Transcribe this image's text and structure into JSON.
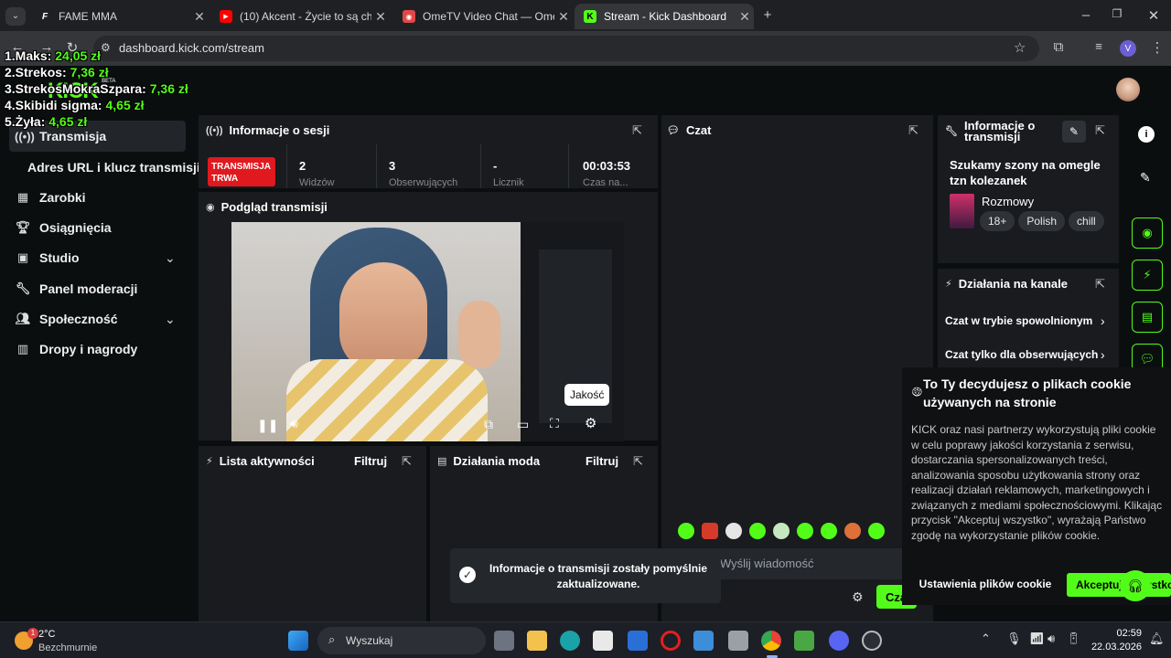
{
  "tabs": [
    {
      "title": "FAME MMA",
      "icon": "fame-icon"
    },
    {
      "title": "(10) Akcent - Życie to są chwile",
      "icon": "youtube-icon"
    },
    {
      "title": "OmeTV Video Chat — Omegle",
      "icon": "ometv-icon"
    },
    {
      "title": "Stream - Kick Dashboard",
      "icon": "kick-icon"
    }
  ],
  "url": "dashboard.kick.com/stream",
  "profile_initial": "V",
  "overlay": [
    {
      "name": "1.Maks:",
      "amount": "24,05 zł"
    },
    {
      "name": "2.Strekos:",
      "amount": "7,36 zł"
    },
    {
      "name": "3.StrekosMokraSzpara:",
      "amount": "7,36 zł"
    },
    {
      "name": "4.Skibidi sigma:",
      "amount": "4,65 zł"
    },
    {
      "name": "5.Żyła:",
      "amount": "4,65 zł"
    }
  ],
  "logo": {
    "text": "KICK",
    "badge": "BETA"
  },
  "sidebar": {
    "items": [
      {
        "label": "Transmisja",
        "icon": "broadcast-icon"
      },
      {
        "label": "Adres URL i klucz transmisji",
        "icon": ""
      },
      {
        "label": "Zarobki",
        "icon": "earnings-icon"
      },
      {
        "label": "Osiągnięcia",
        "icon": "trophy-icon"
      },
      {
        "label": "Studio",
        "icon": "studio-icon"
      },
      {
        "label": "Panel moderacji",
        "icon": "wrench-icon"
      },
      {
        "label": "Społeczność",
        "icon": "community-icon"
      },
      {
        "label": "Dropy i nagrody",
        "icon": "drops-icon"
      }
    ]
  },
  "session": {
    "title": "Informacje o sesji",
    "live_badge": "TRANSMISJA TRWA",
    "stats": [
      "2",
      "3",
      "-",
      "00:03:53"
    ],
    "stat_labels": [
      "Widzów",
      "Obserwujących",
      "Licznik",
      "Czas na..."
    ]
  },
  "preview": {
    "title": "Podgląd transmisji",
    "tooltip": "Jakość",
    "stream_bg": "#3a3a3a"
  },
  "activity": {
    "title": "Lista aktywności",
    "filter": "Filtruj"
  },
  "modactions": {
    "title": "Działania moda",
    "filter": "Filtruj"
  },
  "chat": {
    "title": "Czat",
    "placeholder": "Wyślij wiadomość",
    "send": "Czat"
  },
  "streaminfo": {
    "title": "Informacje o transmisji",
    "stream_title": "Szukamy szony na omegle tzn kolezanek",
    "category": "Rozmowy",
    "tags": [
      "18+",
      "Polish",
      "chill"
    ]
  },
  "channel_actions": {
    "title": "Działania na kanale",
    "items": [
      "Czat w trybie spowolnionym",
      "Czat tylko dla obserwujących"
    ]
  },
  "toast": {
    "text": "Informacje o transmisji zostały pomyślnie zaktualizowane."
  },
  "cookie": {
    "title": "To Ty decydujesz o plikach cookie używanych na stronie",
    "body": "KICK oraz nasi partnerzy wykorzystują pliki cookie w celu poprawy jakości korzystania z serwisu, dostarczania spersonalizowanych treści, analizowania sposobu użytkowania strony oraz realizacji działań reklamowych, marketingowych i związanych z mediami społecznościowymi. Klikając przycisk \"Akceptuj wszystko\", wyrażają Państwo zgodę na wykorzystanie plików cookie.",
    "settings_btn": "Ustawienia plików cookie",
    "accept_btn": "Akceptuj wszystko"
  },
  "taskbar": {
    "weather_temp": "2°C",
    "weather_desc": "Bezchmurnie",
    "weather_badge": "1",
    "search": "Wyszukaj",
    "time": "02:59",
    "date": "22.03.2026"
  },
  "colors": {
    "accent": "#53fc18",
    "live": "#e0191e",
    "panel": "#191b1f",
    "bg": "#0b0e0f"
  }
}
